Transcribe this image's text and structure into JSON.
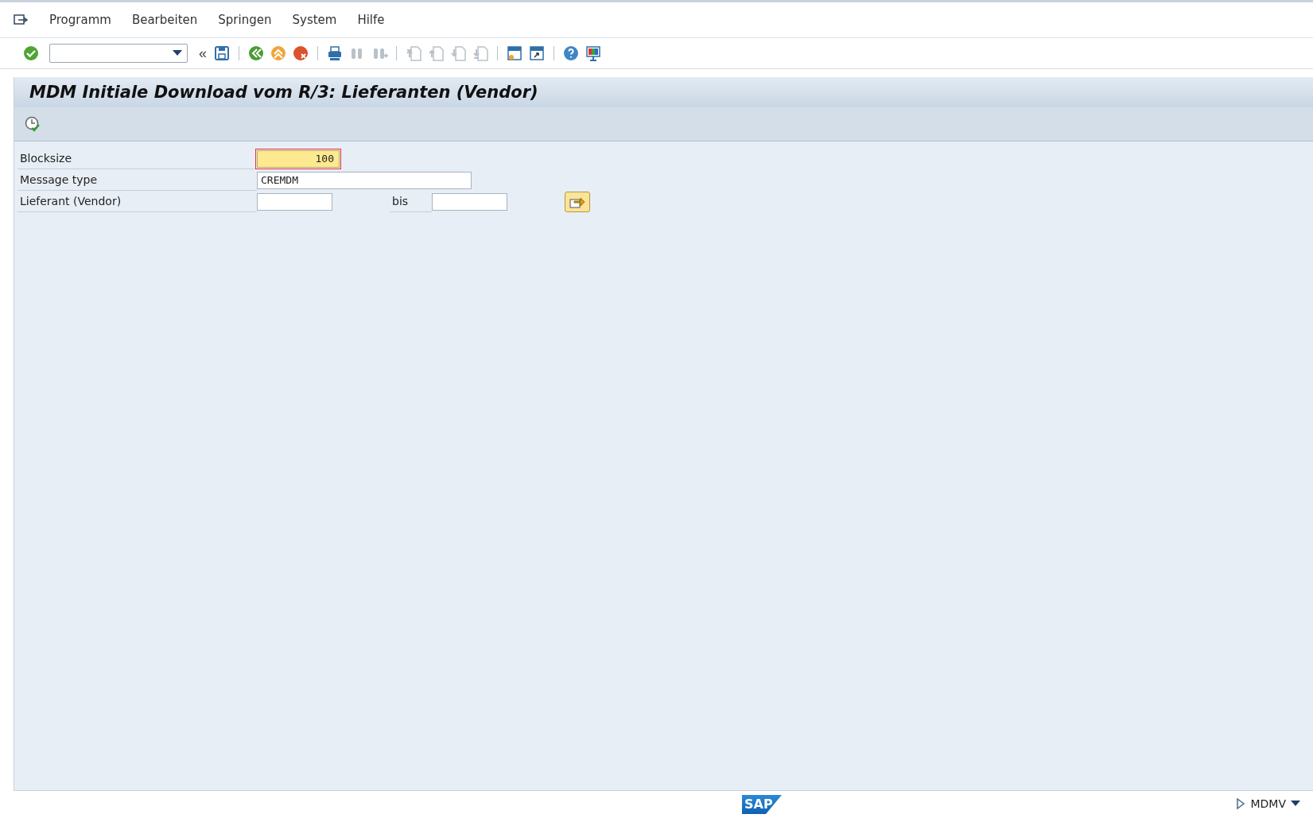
{
  "menu": [
    {
      "label": "Programm"
    },
    {
      "label": "Bearbeiten"
    },
    {
      "label": "Springen"
    },
    {
      "label": "System"
    },
    {
      "label": "Hilfe"
    }
  ],
  "toolbar": [
    {
      "kind": "enter",
      "disabled": false
    },
    {
      "kind": "command-field"
    },
    {
      "kind": "collapse",
      "label": "«",
      "disabled": false
    },
    {
      "kind": "save",
      "disabled": false
    },
    {
      "kind": "sep"
    },
    {
      "kind": "back",
      "disabled": false
    },
    {
      "kind": "exit",
      "disabled": false
    },
    {
      "kind": "cancel",
      "disabled": false
    },
    {
      "kind": "sep"
    },
    {
      "kind": "print",
      "disabled": false
    },
    {
      "kind": "find",
      "disabled": true
    },
    {
      "kind": "find-next",
      "disabled": true
    },
    {
      "kind": "sep"
    },
    {
      "kind": "first-page",
      "disabled": true
    },
    {
      "kind": "prev-page",
      "disabled": true
    },
    {
      "kind": "next-page",
      "disabled": true
    },
    {
      "kind": "last-page",
      "disabled": true
    },
    {
      "kind": "sep"
    },
    {
      "kind": "new-session",
      "disabled": false
    },
    {
      "kind": "shortcut",
      "disabled": false
    },
    {
      "kind": "sep"
    },
    {
      "kind": "help",
      "disabled": false
    },
    {
      "kind": "layout",
      "disabled": false
    }
  ],
  "title": "MDM Initiale Download vom R/3: Lieferanten (Vendor)",
  "fields": [
    {
      "label": "Blocksize",
      "value": "100",
      "focused": true,
      "kind": "number"
    },
    {
      "label": "Message type",
      "value": "CREMDM",
      "focused": false,
      "kind": "text"
    },
    {
      "label": "Lieferant (Vendor)",
      "focused": false,
      "kind": "range",
      "to_label": "bis"
    }
  ],
  "status_bar": {
    "logo": "SAP",
    "transaction": "MDMV"
  }
}
